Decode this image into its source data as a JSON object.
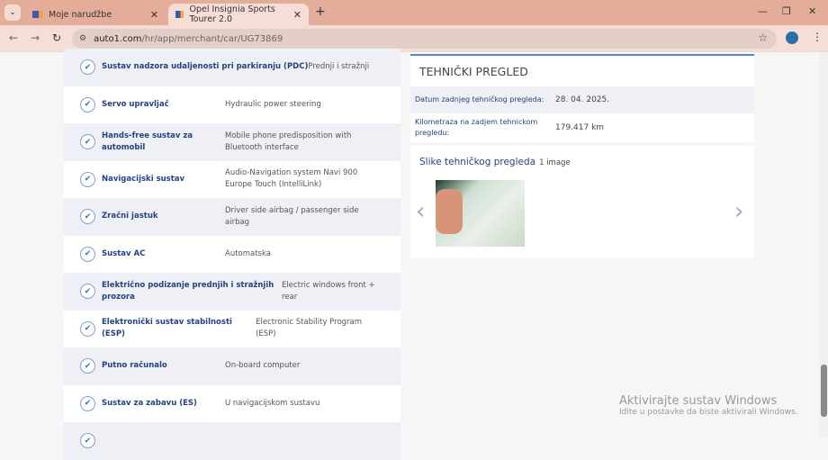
{
  "browser": {
    "tabs": [
      {
        "label": "Moje narudžbe"
      },
      {
        "label": "Opel Insignia Sports Tourer 2.0"
      }
    ],
    "url_domain": "auto1.com",
    "url_path": "/hr/app/merchant/car/UG73869"
  },
  "equipment": [
    {
      "name": "Sustav nadzora udaljenosti pri parkiranju (PDC)",
      "value": "Prednji i stražnji"
    },
    {
      "name": "Servo upravljač",
      "value": "Hydraulic power steering"
    },
    {
      "name": "Hands-free sustav za automobil",
      "value": "Mobile phone predisposition with Bluetooth interface"
    },
    {
      "name": "Navigacijski sustav",
      "value": "Audio-Navigation system Navi 900 Europe Touch (IntelliLink)"
    },
    {
      "name": "Zračni jastuk",
      "value": "Driver side airbag / passenger side airbag"
    },
    {
      "name": "Sustav AC",
      "value": "Automatska"
    },
    {
      "name": "Električno podizanje prednjih i stražnjih prozora",
      "value": "Electric windows front + rear"
    },
    {
      "name": "Elektronički sustav stabilnosti (ESP)",
      "value": "Electronic Stability Program (ESP)"
    },
    {
      "name": "Putno računalo",
      "value": "On-board computer"
    },
    {
      "name": "Sustav za zabavu (ES)",
      "value": "U navigacijskom sustavu"
    }
  ],
  "inspection": {
    "title": "TEHNIČKI PREGLED",
    "rows": [
      {
        "label": "Datum zadnjeg tehničkog pregleda:",
        "value": "28. 04. 2025."
      },
      {
        "label": "Kilometraza na zadjem tehnickom pregledu:",
        "value": "179.417 km"
      }
    ],
    "images_title": "Slike tehničkog pregleda",
    "images_count": "1 image"
  },
  "watermark": {
    "line1": "Aktivirajte sustav Windows",
    "line2": "Idite u postavke da biste aktivirali Windows."
  }
}
